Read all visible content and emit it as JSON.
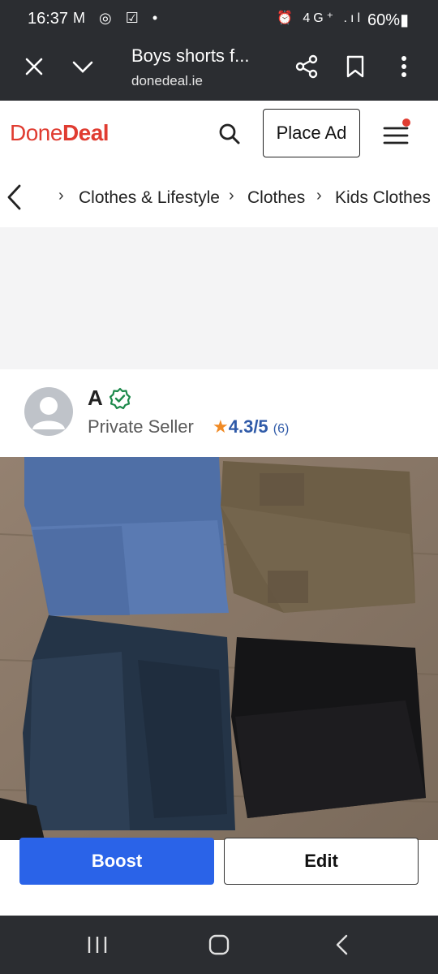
{
  "status_bar": {
    "time": "16:37",
    "left_icons": "M ◎ ☑ •",
    "right_icons": "⏰ 4G⁺ .ıl",
    "battery": "60%▮"
  },
  "tab_bar": {
    "title": "Boys shorts f...",
    "url": "donedeal.ie"
  },
  "site_header": {
    "logo_regular": "Done",
    "logo_bold": "Deal",
    "place_ad_label": "Place Ad"
  },
  "breadcrumb": {
    "items": [
      "Clothes & Lifestyle",
      "Clothes",
      "Kids Clothes"
    ]
  },
  "seller": {
    "name": "A",
    "type": "Private Seller",
    "rating": "4.3/5",
    "rating_count": "(6)"
  },
  "actions": {
    "boost_label": "Boost",
    "edit_label": "Edit"
  },
  "colors": {
    "brand_red": "#e03c31",
    "boost_blue": "#2a63e8",
    "rating_blue": "#2f5aa8",
    "star_orange": "#f08a24",
    "verified_green": "#1e8a4c"
  }
}
